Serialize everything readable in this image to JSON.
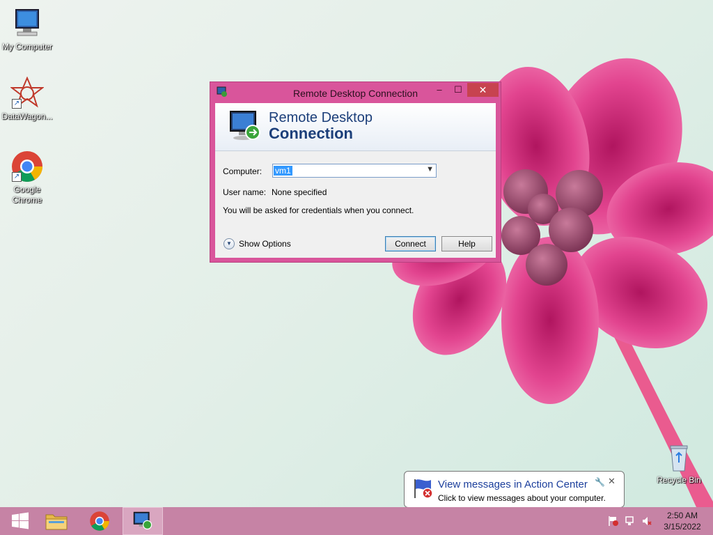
{
  "desktop": {
    "icons": [
      {
        "label": "My Computer"
      },
      {
        "label": "DataWagon..."
      },
      {
        "label": "Google Chrome"
      },
      {
        "label": "Recycle Bin"
      }
    ]
  },
  "rdp_window": {
    "title": "Remote Desktop Connection",
    "banner_line1": "Remote Desktop",
    "banner_line2": "Connection",
    "computer_label": "Computer:",
    "computer_value": "vm1",
    "username_label": "User name:",
    "username_value": "None specified",
    "credentials_note": "You will be asked for credentials when you connect.",
    "show_options_label": "Show Options",
    "connect_label": "Connect",
    "help_label": "Help",
    "minimize_glyph": "–",
    "maximize_glyph": "☐",
    "close_glyph": "✕"
  },
  "notification": {
    "title": "View messages in Action Center",
    "text": "Click to view messages about your computer.",
    "close_glyph": "✕",
    "settings_glyph": "🔧"
  },
  "taskbar": {
    "apps": [
      "start-icon",
      "file-explorer-icon",
      "chrome-icon",
      "remote-desktop-icon"
    ],
    "clock_time": "2:50 AM",
    "clock_date": "3/15/2022"
  },
  "colors": {
    "taskbar": "#c683a5",
    "window_frame": "#d9559b",
    "close_button": "#c7434f",
    "banner_text": "#1c3f7a",
    "selection": "#3399ff"
  }
}
